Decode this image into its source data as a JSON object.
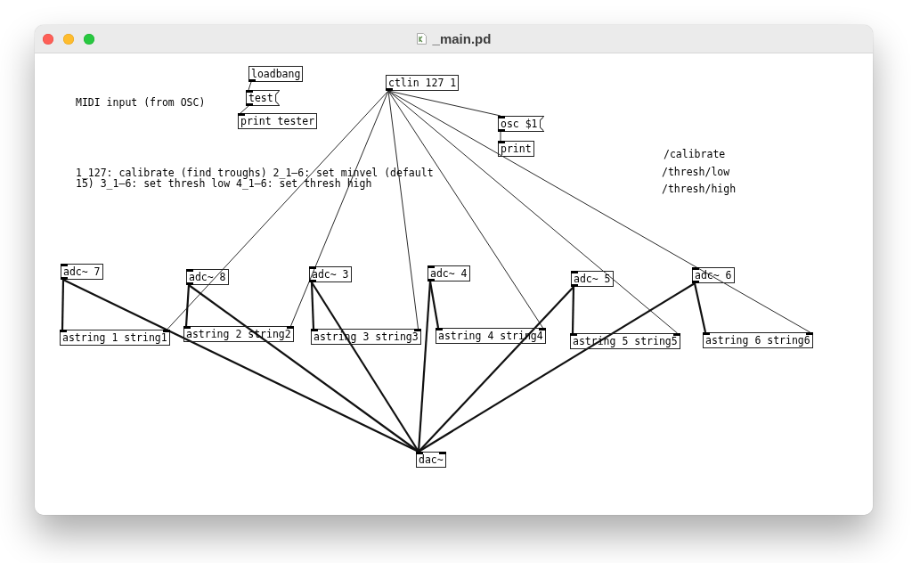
{
  "window": {
    "title": "_main.pd"
  },
  "patch": {
    "objects": [
      {
        "kind": "object",
        "text": "loadbang"
      },
      {
        "kind": "object",
        "text": "ctlin 127 1"
      },
      {
        "kind": "message",
        "text": "test"
      },
      {
        "kind": "comment",
        "text": "MIDI input (from OSC)"
      },
      {
        "kind": "object",
        "text": "print tester"
      },
      {
        "kind": "message",
        "text": "osc $1"
      },
      {
        "kind": "object",
        "text": "print"
      },
      {
        "kind": "comment",
        "text": "/calibrate"
      },
      {
        "kind": "comment",
        "text": "1_127: calibrate (find troughs) 2_1–6: set minvel (default 15) 3_1–6: set thresh low 4_1–6: set thresh high"
      },
      {
        "kind": "comment",
        "text": "/thresh/low"
      },
      {
        "kind": "comment",
        "text": "/thresh/high"
      },
      {
        "kind": "object",
        "text": "adc~ 7"
      },
      {
        "kind": "object",
        "text": "adc~ 8"
      },
      {
        "kind": "object",
        "text": "adc~ 3"
      },
      {
        "kind": "object",
        "text": "adc~ 4"
      },
      {
        "kind": "object",
        "text": "adc~ 5"
      },
      {
        "kind": "object",
        "text": "adc~ 6"
      },
      {
        "kind": "object",
        "text": "astring 1 string1"
      },
      {
        "kind": "object",
        "text": "astring 2 string2"
      },
      {
        "kind": "object",
        "text": "astring 3 string3"
      },
      {
        "kind": "object",
        "text": "astring 4 string4"
      },
      {
        "kind": "object",
        "text": "astring 5 string5"
      },
      {
        "kind": "object",
        "text": "astring 6 string6"
      },
      {
        "kind": "object",
        "text": "dac~"
      }
    ],
    "connections": [
      {
        "kind": "control"
      },
      {
        "kind": "control"
      },
      {
        "kind": "control"
      },
      {
        "kind": "control"
      },
      {
        "kind": "control"
      },
      {
        "kind": "control"
      },
      {
        "kind": "control"
      },
      {
        "kind": "control"
      },
      {
        "kind": "control"
      },
      {
        "kind": "control"
      },
      {
        "kind": "signal"
      },
      {
        "kind": "signal"
      },
      {
        "kind": "signal"
      },
      {
        "kind": "signal"
      },
      {
        "kind": "signal"
      },
      {
        "kind": "signal"
      },
      {
        "kind": "signal"
      },
      {
        "kind": "signal"
      },
      {
        "kind": "signal"
      },
      {
        "kind": "signal"
      },
      {
        "kind": "signal"
      },
      {
        "kind": "signal"
      }
    ]
  }
}
